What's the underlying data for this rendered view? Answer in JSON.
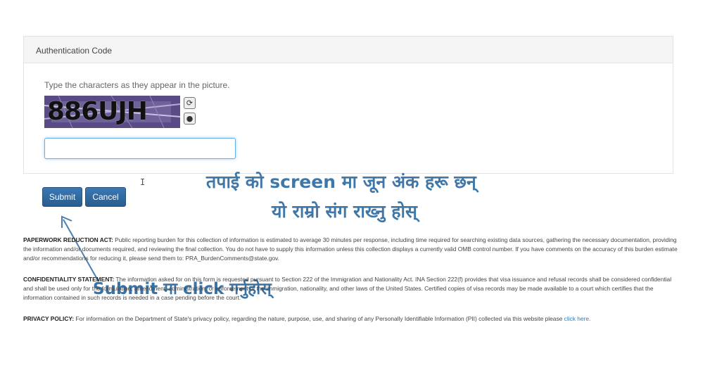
{
  "panel": {
    "title": "Authentication Code",
    "instruction": "Type the characters as they appear in the picture.",
    "captcha_text": "886UJH",
    "input_value": ""
  },
  "buttons": {
    "submit": "Submit",
    "cancel": "Cancel"
  },
  "overlay": {
    "line1": "तपाई को screen मा जून अंक हरू छन्",
    "line2": "यो राम्रो संग राख्नु होस्",
    "submit_hint": "Submit मा click गर्नुहोस्"
  },
  "legal": {
    "paperwork_label": "PAPERWORK REDUCTION ACT:",
    "paperwork_text": " Public reporting burden for this collection of information is estimated to average 30 minutes per response, including time required for searching existing data sources, gathering the necessary documentation, providing the information and/or documents required, and reviewing the final collection. You do not have to supply this information unless this collection displays a currently valid OMB control number. If you have comments on the accuracy of this burden estimate and/or recommendations for reducing it, please send them to: PRA_BurdenComments@state.gov.",
    "confidentiality_label": "CONFIDENTIALITY STATEMENT:",
    "confidentiality_text": " The information asked for on this form is requested pursuant to Section 222 of the Immigration and Nationality Act. INA Section 222(f) provides that visa issuance and refusal records shall be considered confidential and shall be used only for the formulation, amendment, administration, or enforcement of the immigration, nationality, and other laws of the United States. Certified copies of visa records may be made available to a court which certifies that the information contained in such records is needed in a case pending before the court.",
    "privacy_label": "PRIVACY POLICY:",
    "privacy_text": " For information on the Department of State's privacy policy, regarding the nature, purpose, use, and sharing of any Personally Identifiable Information (PII) collected via this website please ",
    "privacy_link": "click here."
  },
  "colors": {
    "button": "#2f6da3",
    "overlay_text": "#3f78a8",
    "captcha_bg": "#5a4b86",
    "link": "#337ab7"
  }
}
